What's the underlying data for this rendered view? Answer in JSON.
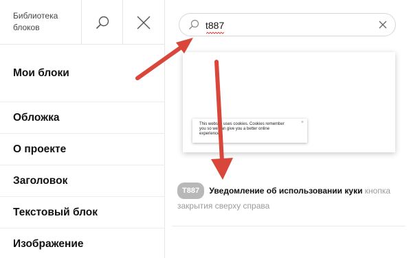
{
  "sidebar": {
    "library_title": "Библиотека блоков",
    "search_icon": "search-icon",
    "close_icon": "close-icon",
    "items": [
      {
        "label": "Мои блоки"
      },
      {
        "label": "Обложка"
      },
      {
        "label": "О проекте"
      },
      {
        "label": "Заголовок"
      },
      {
        "label": "Текстовый блок"
      },
      {
        "label": "Изображение"
      }
    ]
  },
  "search": {
    "value": "t887",
    "icon": "search-icon",
    "clear_icon": "close-icon"
  },
  "preview": {
    "cookie_text_1": "This website uses cookies. Cookies remember",
    "cookie_text_2": "you so we can give you a better online",
    "cookie_text_3": "experience.",
    "cookie_close": "×"
  },
  "result": {
    "badge": "T887",
    "title": "Уведомление об использовании куки",
    "description": "кнопка закрытия сверху справа"
  },
  "colors": {
    "arrow": "#d9473b",
    "badge": "#b8b8b8",
    "border": "#e6e6e6"
  }
}
